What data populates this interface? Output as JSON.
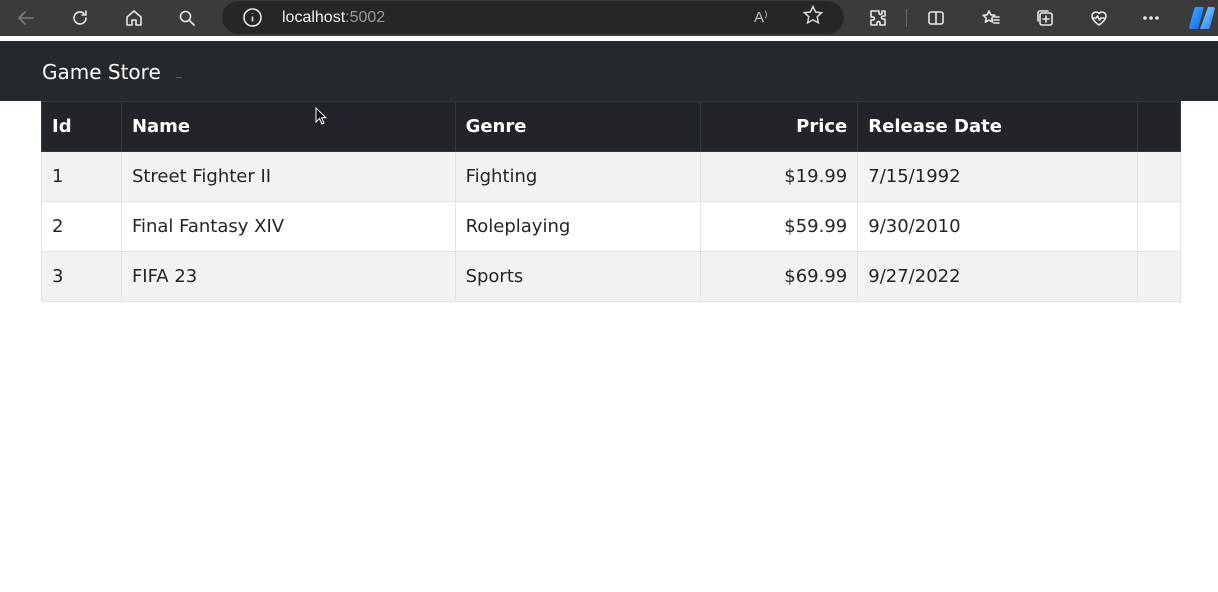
{
  "browser": {
    "url_host": "localhost",
    "url_port": ":5002",
    "read_aloud_label": "A⁾"
  },
  "app": {
    "brand": "Game Store"
  },
  "table": {
    "headers": [
      "Id",
      "Name",
      "Genre",
      "Price",
      "Release Date",
      ""
    ],
    "rows": [
      {
        "id": "1",
        "name": "Street Fighter II",
        "genre": "Fighting",
        "price": "$19.99",
        "release_date": "7/15/1992"
      },
      {
        "id": "2",
        "name": "Final Fantasy XIV",
        "genre": "Roleplaying",
        "price": "$59.99",
        "release_date": "9/30/2010"
      },
      {
        "id": "3",
        "name": "FIFA 23",
        "genre": "Sports",
        "price": "$69.99",
        "release_date": "9/27/2022"
      }
    ]
  },
  "colors": {
    "navbar": "#24292d",
    "table_header": "#212529",
    "row_stripe": "#f2f2f2",
    "browser_chrome": "#3b3b3b"
  }
}
